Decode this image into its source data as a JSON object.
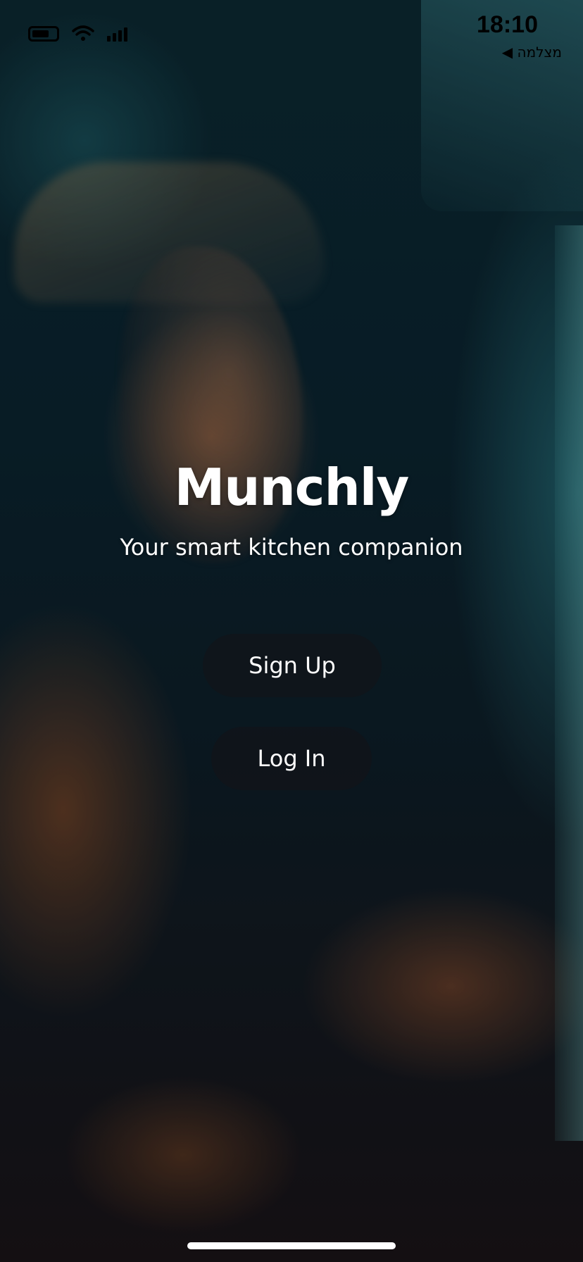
{
  "status_bar": {
    "time": "18:10",
    "back_label": "מצלמה ◀",
    "icons": [
      "battery-icon",
      "wifi-icon",
      "signal-icon"
    ]
  },
  "app": {
    "title": "Munchly",
    "tagline": "Your smart kitchen companion"
  },
  "actions": {
    "signup_label": "Sign Up",
    "login_label": "Log In"
  },
  "colors": {
    "text": "#ffffff",
    "button_bg": "rgba(20,20,24,0.62)",
    "background": "#0b2430"
  }
}
